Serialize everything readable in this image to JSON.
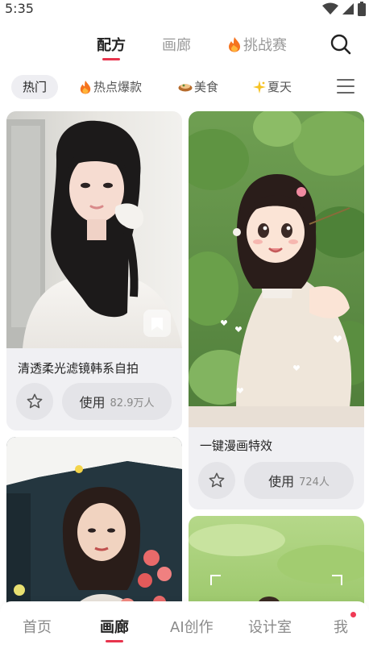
{
  "status": {
    "time": "5:35"
  },
  "top_tabs": [
    "配方",
    "画廊",
    "挑战赛"
  ],
  "categories": [
    {
      "label": "热门",
      "icon": ""
    },
    {
      "label": "热点爆款",
      "icon": "fire-icon"
    },
    {
      "label": "美食",
      "icon": "food-icon"
    },
    {
      "label": "夏天",
      "icon": "sparkle-icon"
    }
  ],
  "cards": [
    {
      "title": "清透柔光滤镜韩系自拍",
      "use_label": "使用",
      "count": "82.9万人"
    },
    {
      "title": "一键漫画特效",
      "use_label": "使用",
      "count": "724人"
    }
  ],
  "bottom_tabs": [
    "首页",
    "画廊",
    "AI创作",
    "设计室",
    "我"
  ],
  "colors": {
    "accent": "#e8344d",
    "card_bg": "#f0f0f3",
    "button_bg": "#e4e4e8"
  }
}
